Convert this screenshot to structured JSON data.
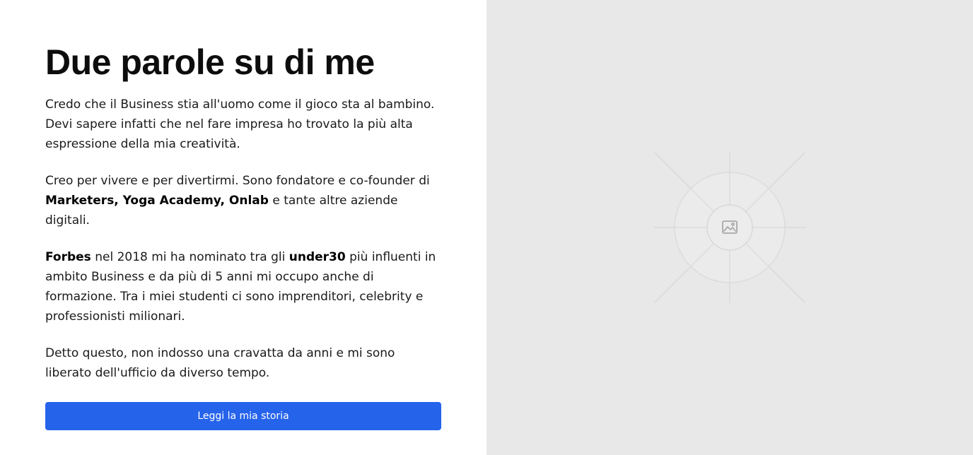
{
  "about": {
    "heading": "Due parole su di me",
    "p1": "Credo che il Business stia all'uomo come il gioco sta al bambino. Devi sapere infatti che nel fare impresa ho trovato la più alta espressione della mia creatività.",
    "p2_text1": "Creo per vivere e per divertirmi. Sono fondatore e co-founder di ",
    "p2_bold": "Marketers, Yoga Academy, Onlab",
    "p2_text2": " e tante altre aziende digitali.",
    "p3_bold1": "Forbes",
    "p3_text1": " nel 2018 mi ha nominato tra gli ",
    "p3_bold2": "under30",
    "p3_text2": " più influenti in ambito Business e da più di 5 anni mi occupo anche di formazione. Tra i miei studenti ci sono imprenditori, celebrity e professionisti milionari.",
    "p4": "Detto questo, non indosso una cravatta da anni e mi sono liberato dell'ufficio da diverso tempo.",
    "cta_label": "Leggi la mia storia"
  },
  "image_placeholder": {
    "icon": "image-icon",
    "background_color": "#e8e8e8"
  },
  "colors": {
    "button": "#2563eb",
    "button_text": "#ffffff"
  }
}
